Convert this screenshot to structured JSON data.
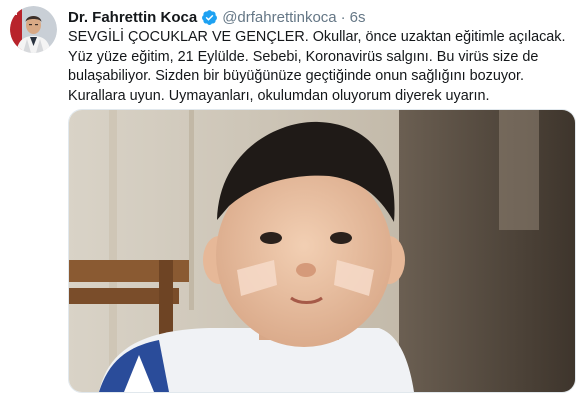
{
  "tweet": {
    "author": {
      "display_name": "Dr. Fahrettin Koca",
      "handle": "@drfahrettinkoca",
      "verified": true,
      "avatar_icon": "profile-photo"
    },
    "separator": "·",
    "timestamp": "6s",
    "text_lines": [
      "SEVGİLİ ÇOCUKLAR VE GENÇLER. Okullar, önce uzaktan eğitimle açılacak.",
      "Yüz yüze eğitim, 21 Eylülde. Sebebi, Koronavirüs salgını. Bu virüs size de",
      "bulaşabiliyor. Sizden bir büyüğünüze geçtiğinde onun sağlığını bozuyor.",
      "Kurallara uyun. Uymayanları, okulumdan oluyorum diyerek uyarın."
    ],
    "media": {
      "type": "photo"
    }
  },
  "colors": {
    "text": "#14171a",
    "secondary": "#657786",
    "verified_badge": "#1da1f2",
    "border": "#e1e8ed"
  }
}
